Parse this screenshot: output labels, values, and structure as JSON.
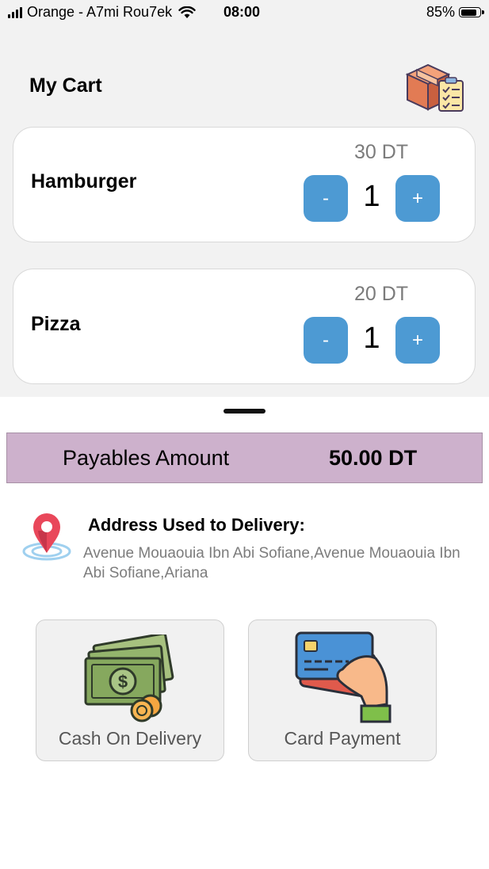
{
  "status_bar": {
    "carrier": "Orange - A7mi Rou7ek",
    "time": "08:00",
    "battery": "85%"
  },
  "header": {
    "title": "My Cart",
    "icon": "delivery-box-checklist-icon"
  },
  "cart_items": [
    {
      "name": "Hamburger",
      "price": "30 DT",
      "quantity": "1",
      "minus_label": "-",
      "plus_label": "+"
    },
    {
      "name": "Pizza",
      "price": "20 DT",
      "quantity": "1",
      "minus_label": "-",
      "plus_label": "+"
    }
  ],
  "summary": {
    "label": "Payables Amount",
    "amount": "50.00 DT"
  },
  "address": {
    "title": "Address Used to Delivery:",
    "text": "Avenue Mouaouia Ibn Abi Sofiane,Avenue Mouaouia Ibn Abi Sofiane,Ariana",
    "icon": "map-pin-icon"
  },
  "payment_options": [
    {
      "label": "Cash On Delivery",
      "icon": "cash-icon"
    },
    {
      "label": "Card Payment",
      "icon": "credit-card-icon"
    }
  ],
  "colors": {
    "accent_button": "#4d9ad3",
    "summary_bar": "#cdb1cc",
    "top_background": "#f2f2f2"
  }
}
